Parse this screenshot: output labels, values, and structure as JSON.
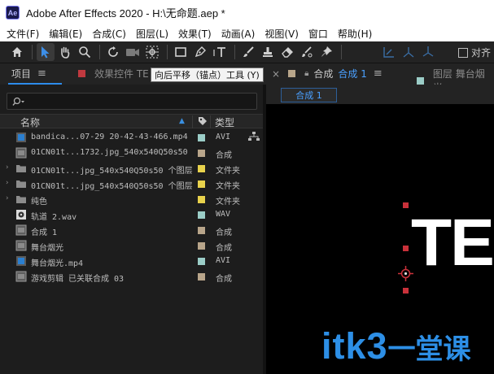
{
  "window": {
    "title": "Adobe After Effects 2020 - H:\\无命题.aep *",
    "logo": "Ae"
  },
  "menu": [
    "文件(F)",
    "编辑(E)",
    "合成(C)",
    "图层(L)",
    "效果(T)",
    "动画(A)",
    "视图(V)",
    "窗口",
    "帮助(H)"
  ],
  "toolbar": {
    "align_label": "对齐"
  },
  "tooltip": "向后平移（锚点）工具 (Y)",
  "panels": {
    "project_tab": "项目",
    "effects_tab": "效果控件 TE",
    "comp_tab": "合成",
    "comp_tab_active": "合成 1",
    "layer_tab": "图层 舞台烟光",
    "comp_chip": "合成 1"
  },
  "project": {
    "columns": {
      "name": "名称",
      "type": "类型"
    },
    "items": [
      {
        "name": "bandica...07-29 20-42-43-466.mp4",
        "type": "AVI",
        "icon": "video-file-icon",
        "label_color": "#9bcdc7",
        "expand": false
      },
      {
        "name": "01CN01t...1732.jpg_540x540Q50s50",
        "type": "合成",
        "icon": "composition-icon",
        "label_color": "#b8a58a",
        "expand": false
      },
      {
        "name": "01CN01t...jpg_540x540Q50s50 个图层",
        "type": "文件夹",
        "icon": "folder-icon",
        "label_color": "#e8d24c",
        "expand": true
      },
      {
        "name": "01CN01t...jpg_540x540Q50s50 个图层",
        "type": "文件夹",
        "icon": "folder-icon",
        "label_color": "#e8d24c",
        "expand": true
      },
      {
        "name": "纯色",
        "type": "文件夹",
        "icon": "folder-icon",
        "label_color": "#e8d24c",
        "expand": true
      },
      {
        "name": "轨道 2.wav",
        "type": "WAV",
        "icon": "audio-file-icon",
        "label_color": "#9bcdc7",
        "expand": false
      },
      {
        "name": "合成 1",
        "type": "合成",
        "icon": "composition-icon",
        "label_color": "#b8a58a",
        "expand": false
      },
      {
        "name": "舞台烟光",
        "type": "合成",
        "icon": "composition-icon",
        "label_color": "#b8a58a",
        "expand": false
      },
      {
        "name": "舞台烟光.mp4",
        "type": "AVI",
        "icon": "video-file-icon",
        "label_color": "#9bcdc7",
        "expand": false
      },
      {
        "name": "游戏剪辑 已关联合成 03",
        "type": "合成",
        "icon": "composition-icon",
        "label_color": "#b8a58a",
        "expand": false
      }
    ]
  },
  "viewer": {
    "text": "TE"
  },
  "watermark": {
    "latin": "itk3",
    "cn": "一堂课"
  },
  "colors": {
    "accent_blue": "#2d8ceb",
    "handle_red": "#c9313a",
    "titlebar_bg": "#ffffff"
  }
}
